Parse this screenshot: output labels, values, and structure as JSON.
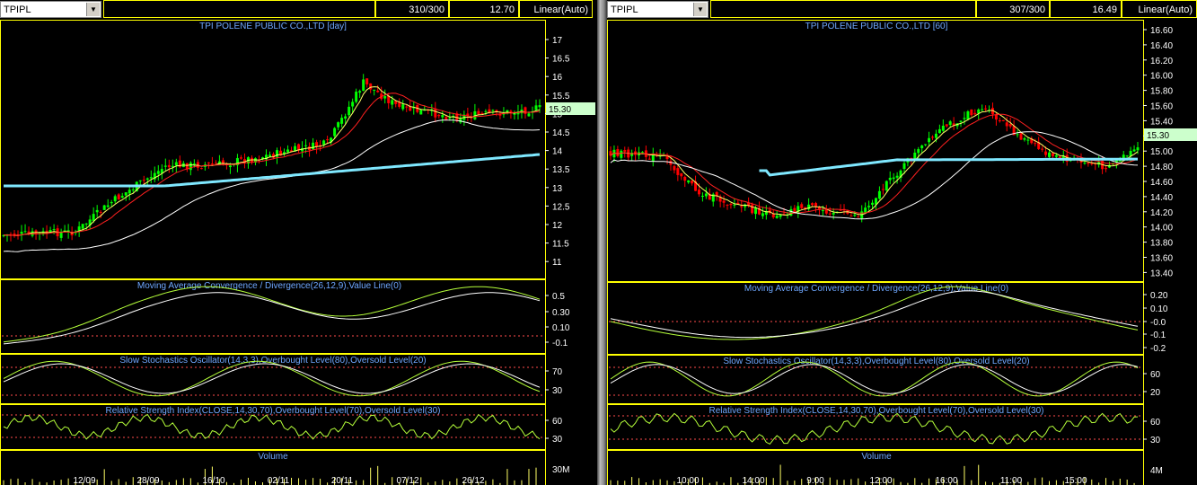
{
  "left": {
    "symbol": "TPIPL",
    "bar_count": "310/300",
    "last_value": "12.70",
    "scale_mode": "Linear(Auto)",
    "price_title": "TPI POLENE PUBLIC CO.,LTD [day]",
    "price_ticks": [
      "17",
      "16.5",
      "16",
      "15.5",
      "15",
      "14.5",
      "14",
      "13.5",
      "13",
      "12.5",
      "12",
      "11.5",
      "11"
    ],
    "last_price": "15.30",
    "macd_title": "Moving Average Convergence / Divergence(26,12,9),Value Line(0)",
    "macd_ticks": [
      "0.5",
      "0.30",
      "0.10",
      "-0.1"
    ],
    "stoch_title": "Slow Stochastics Oscillator(14,3,3),Overbought Level(80),Oversold Level(20)",
    "stoch_ticks": [
      "70",
      "30"
    ],
    "rsi_title": "Relative Strength Index(CLOSE,14,30,70),Overbought Level(70),Oversold Level(30)",
    "rsi_ticks": [
      "60",
      "30"
    ],
    "volume_title": "Volume",
    "volume_tick": "30M",
    "dates": [
      "12/09",
      "28/09",
      "16/10",
      "02/11",
      "20/11",
      "07/12",
      "26/12"
    ]
  },
  "right": {
    "symbol": "TPIPL",
    "bar_count": "307/300",
    "last_value": "16.49",
    "scale_mode": "Linear(Auto)",
    "price_title": "TPI POLENE PUBLIC CO.,LTD [60]",
    "price_ticks": [
      "16.60",
      "16.40",
      "16.20",
      "16.00",
      "15.80",
      "15.60",
      "15.40",
      "15.20",
      "15.00",
      "14.80",
      "14.60",
      "14.40",
      "14.20",
      "14.00",
      "13.80",
      "13.60",
      "13.40"
    ],
    "last_price": "15.30",
    "macd_title": "Moving Average Convergence / Divergence(26,12,9),Value Line(0)",
    "macd_ticks": [
      "0.20",
      "0.10",
      "-0.0",
      "-0.1",
      "-0.2"
    ],
    "stoch_title": "Slow Stochastics Oscillator(14,3,3),Overbought Level(80),Oversold Level(20)",
    "stoch_ticks": [
      "60",
      "20"
    ],
    "rsi_title": "Relative Strength Index(CLOSE,14,30,70),Overbought Level(70),Oversold Level(30)",
    "rsi_ticks": [
      "60",
      "30"
    ],
    "volume_title": "Volume",
    "volume_tick": "4M",
    "times": [
      "10:00",
      "14:00",
      "9:00",
      "12:00",
      "16:00",
      "11:00",
      "15:00"
    ]
  },
  "colors": {
    "frame": "#ffff00",
    "up": "#00ff00",
    "down": "#ff0000",
    "ma_fast": "#ffff66",
    "ma_mid": "#ff2020",
    "ma_slow": "#ffffff",
    "ma_long": "#7fe8ff",
    "indicator": "#b5ff3a",
    "signal": "#ffffff",
    "level": "#ff4d4d",
    "title": "#6fa8ff",
    "last_price_bg": "#ccffcc"
  }
}
